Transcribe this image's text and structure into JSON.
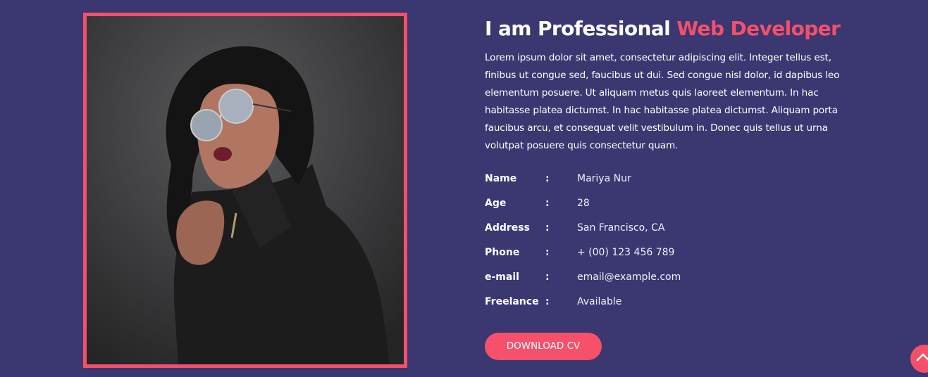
{
  "about": {
    "heading_prefix": "I am Professional ",
    "heading_accent": "Web Developer",
    "description": "Lorem ipsum dolor sit amet, consectetur adipiscing elit. Integer tellus est, finibus ut congue sed, faucibus ut dui. Sed congue nisl dolor, id dapibus leo elementum posuere. Ut aliquam metus quis laoreet elementum. In hac habitasse platea dictumst. In hac habitasse platea dictumst. Aliquam porta faucibus arcu, et consequat velit vestibulum in. Donec quis tellus ut urna volutpat posuere quis consectetur quam.",
    "info": [
      {
        "label": "Name",
        "sep": ":",
        "value": "Mariya Nur"
      },
      {
        "label": "Age",
        "sep": ":",
        "value": "28"
      },
      {
        "label": "Address",
        "sep": ":",
        "value": "San Francisco, CA"
      },
      {
        "label": "Phone",
        "sep": ":",
        "value": "+ (00) 123 456 789"
      },
      {
        "label": "e-mail",
        "sep": ":",
        "value": "email@example.com"
      },
      {
        "label": "Freelance",
        "sep": ":",
        "value": "Available"
      }
    ],
    "download_label": "DOWNLOAD CV"
  },
  "icons": {
    "scroll_top": "chevron-up-icon"
  },
  "colors": {
    "background": "#3b3771",
    "accent": "#f3506a",
    "text": "#ffffff"
  }
}
